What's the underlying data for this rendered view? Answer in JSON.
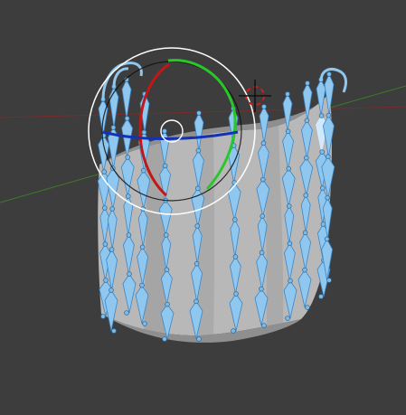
{
  "viewport": {
    "background": "#3d3d3d",
    "axis_x_color": "#7a2c2c",
    "axis_y_color": "#3f7a28",
    "mesh_color": "#b8b8b8",
    "bone_color": "#8fc7ef",
    "bone_outline_color": "#3d86c6",
    "gizmo": {
      "outer_ring_color": "#ffffff",
      "x_ring_color": "#c31717",
      "y_ring_color": "#29c72a",
      "z_ring_color": "#1532b5"
    },
    "cursor_icon": "3d-cursor-icon"
  }
}
